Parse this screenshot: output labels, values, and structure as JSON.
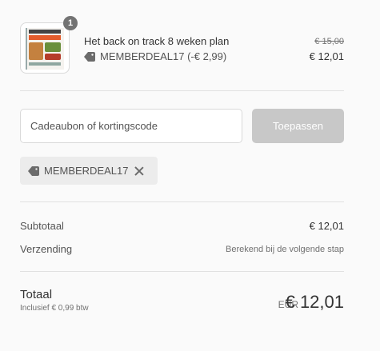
{
  "product": {
    "quantity": "1",
    "name": "Het back on track 8 weken plan",
    "discount_line": "MEMBERDEAL17 (-€ 2,99)",
    "old_price": "€ 15,00",
    "new_price": "€ 12,01",
    "thumbnail_icon": "book-cover-image"
  },
  "discount_form": {
    "placeholder": "Cadeaubon of kortingscode",
    "apply_label": "Toepassen"
  },
  "applied_code": {
    "code": "MEMBERDEAL17",
    "icon": "tag-icon",
    "remove_icon": "close-icon"
  },
  "summary": {
    "subtotal_label": "Subtotaal",
    "subtotal_value": "€ 12,01",
    "shipping_label": "Verzending",
    "shipping_value": "Berekend bij de volgende stap"
  },
  "total": {
    "label": "Totaal",
    "tax_note": "Inclusief € 0,99 btw",
    "currency": "EUR",
    "amount": "€ 12,01"
  },
  "colors": {
    "background": "#fafafa",
    "button_disabled": "#c8c8c8",
    "tag_background": "#ececec",
    "badge": "#737373"
  }
}
